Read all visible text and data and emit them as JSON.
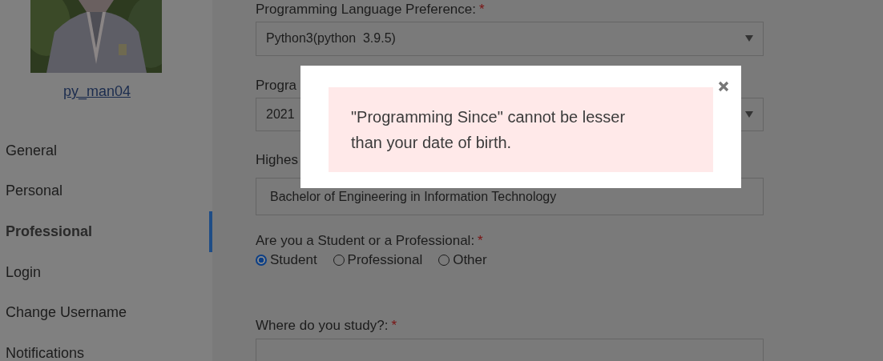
{
  "sidebar": {
    "username": "py_man04",
    "items": [
      {
        "label": "General",
        "selected": false
      },
      {
        "label": "Personal",
        "selected": false
      },
      {
        "label": "Professional",
        "selected": true
      },
      {
        "label": "Login",
        "selected": false
      },
      {
        "label": "Change Username",
        "selected": false
      },
      {
        "label": "Notifications",
        "selected": false
      }
    ]
  },
  "form": {
    "fields": [
      {
        "kind": "select",
        "label": "Programming Language Preference:",
        "required_mark": "*",
        "value": "Python3(python  3.9.5)"
      },
      {
        "kind": "select",
        "label": "Progra",
        "value": "2021"
      },
      {
        "kind": "input",
        "label": "Highes",
        "value": "Bachelor of Engineering in Information Technology"
      },
      {
        "kind": "radio",
        "label": "Are you a Student or a Professional:",
        "required_mark": "*",
        "options": [
          {
            "label": "Student",
            "selected": true
          },
          {
            "label": "Professional",
            "selected": false
          },
          {
            "label": "Other",
            "selected": false
          }
        ]
      },
      {
        "kind": "input",
        "label": "Where do you study?:",
        "required_mark": "*"
      }
    ]
  },
  "dialog": {
    "message": "\"Programming Since\" cannot be lesser than your date of birth."
  }
}
